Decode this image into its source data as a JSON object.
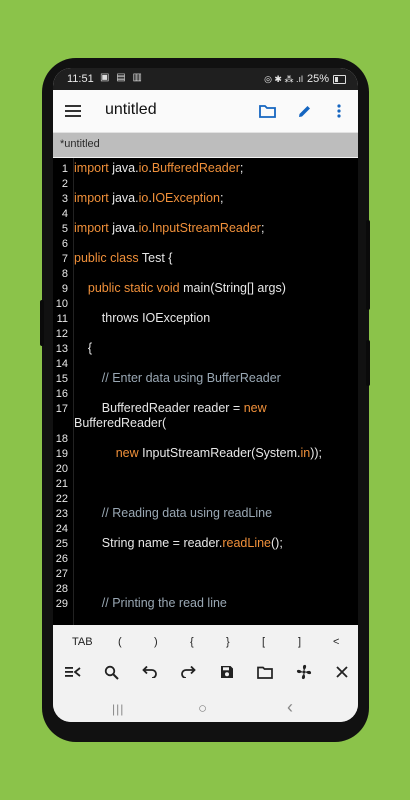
{
  "status": {
    "time": "11:51",
    "left_icons": "▣ ▤ ▥",
    "right_icons": "◎ ✱ ⁂ .ıl",
    "battery": "25%"
  },
  "appbar": {
    "title": "untitled",
    "menu_icon": "menu-icon",
    "folder_icon": "folder-icon",
    "edit_icon": "pencil-icon",
    "more_icon": "more-vert-icon"
  },
  "tab": {
    "label": "*untitled"
  },
  "editor": {
    "lines": [
      {
        "n": "1",
        "segs": [
          {
            "t": "import",
            "k": "kw"
          },
          {
            "t": " java.",
            "k": ""
          },
          {
            "t": "io",
            "k": "kw"
          },
          {
            "t": ".",
            "k": ""
          },
          {
            "t": "BufferedReader",
            "k": "kw"
          },
          {
            "t": ";",
            "k": ""
          }
        ]
      },
      {
        "n": "2",
        "segs": []
      },
      {
        "n": "3",
        "segs": [
          {
            "t": "import",
            "k": "kw"
          },
          {
            "t": " java.",
            "k": ""
          },
          {
            "t": "io",
            "k": "kw"
          },
          {
            "t": ".",
            "k": ""
          },
          {
            "t": "IOException",
            "k": "kw"
          },
          {
            "t": ";",
            "k": ""
          }
        ]
      },
      {
        "n": "4",
        "segs": []
      },
      {
        "n": "5",
        "segs": [
          {
            "t": "import",
            "k": "kw"
          },
          {
            "t": " java.",
            "k": ""
          },
          {
            "t": "io",
            "k": "kw"
          },
          {
            "t": ".",
            "k": ""
          },
          {
            "t": "InputStreamReader",
            "k": "kw"
          },
          {
            "t": ";",
            "k": ""
          }
        ]
      },
      {
        "n": "6",
        "segs": []
      },
      {
        "n": "7",
        "segs": [
          {
            "t": "public class",
            "k": "kw"
          },
          {
            "t": " Test {",
            "k": ""
          }
        ]
      },
      {
        "n": "8",
        "segs": []
      },
      {
        "n": "9",
        "segs": [
          {
            "t": "    ",
            "k": ""
          },
          {
            "t": "public static void",
            "k": "kw"
          },
          {
            "t": " main(String[] args)",
            "k": ""
          }
        ]
      },
      {
        "n": "10",
        "segs": []
      },
      {
        "n": "11",
        "segs": [
          {
            "t": "        throws IOException",
            "k": ""
          }
        ]
      },
      {
        "n": "12",
        "segs": []
      },
      {
        "n": "13",
        "segs": [
          {
            "t": "    {",
            "k": ""
          }
        ]
      },
      {
        "n": "14",
        "segs": []
      },
      {
        "n": "15",
        "segs": [
          {
            "t": "        // Enter data using BufferReader",
            "k": "cm"
          }
        ]
      },
      {
        "n": "16",
        "segs": []
      },
      {
        "n": "17",
        "segs": [
          {
            "t": "        BufferedReader reader = ",
            "k": ""
          },
          {
            "t": "new",
            "k": "kw"
          },
          {
            "t": " BufferedReader(",
            "k": ""
          }
        ]
      },
      {
        "n": "18",
        "segs": []
      },
      {
        "n": "19",
        "segs": [
          {
            "t": "            ",
            "k": ""
          },
          {
            "t": "new",
            "k": "kw"
          },
          {
            "t": " InputStreamReader(System.",
            "k": ""
          },
          {
            "t": "in",
            "k": "kw"
          },
          {
            "t": "));",
            "k": ""
          }
        ]
      },
      {
        "n": "20",
        "segs": []
      },
      {
        "n": "21",
        "segs": []
      },
      {
        "n": "22",
        "segs": []
      },
      {
        "n": "23",
        "segs": [
          {
            "t": "        // Reading data using readLine",
            "k": "cm"
          }
        ]
      },
      {
        "n": "24",
        "segs": []
      },
      {
        "n": "25",
        "segs": [
          {
            "t": "        String name = reader.",
            "k": ""
          },
          {
            "t": "readLine",
            "k": "kw"
          },
          {
            "t": "();",
            "k": ""
          }
        ]
      },
      {
        "n": "26",
        "segs": []
      },
      {
        "n": "27",
        "segs": []
      },
      {
        "n": "28",
        "segs": []
      },
      {
        "n": "29",
        "segs": [
          {
            "t": "        // Printing the read line",
            "k": "cm"
          }
        ]
      }
    ]
  },
  "symbols": [
    "TAB",
    "(",
    ")",
    "{",
    "}",
    "[",
    "]",
    "<"
  ],
  "tools": [
    {
      "name": "keyboard-hide-icon"
    },
    {
      "name": "search-icon"
    },
    {
      "name": "undo-icon"
    },
    {
      "name": "redo-icon"
    },
    {
      "name": "save-icon"
    },
    {
      "name": "open-folder-icon"
    },
    {
      "name": "fan-icon"
    },
    {
      "name": "close-icon"
    }
  ],
  "nav": {
    "recents": "|||",
    "home": "○",
    "back": "‹"
  },
  "colors": {
    "accent": "#1565c0",
    "keyword": "#f0903a",
    "comment": "#9aa8b4",
    "background": "#8bc34a"
  }
}
